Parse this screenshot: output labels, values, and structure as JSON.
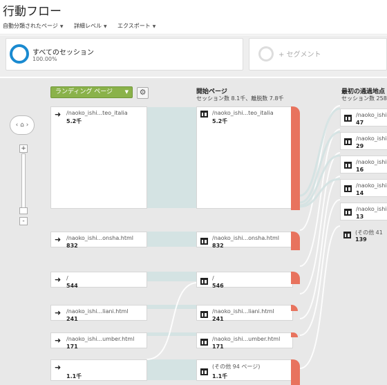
{
  "page": {
    "title": "行動フロー"
  },
  "toolbar": {
    "items": [
      {
        "label": "自動分類されたページ"
      },
      {
        "label": "詳細レベル"
      },
      {
        "label": "エクスポート"
      }
    ]
  },
  "segments": {
    "active": {
      "name": "すべてのセッション",
      "percent": "100.00%"
    },
    "add_label": "+ セグメント"
  },
  "zoom": {
    "home_icon": "home-icon",
    "plus": "+",
    "minus": "-"
  },
  "dimension": {
    "selected": "ランディング ページ"
  },
  "columns": {
    "start": {
      "title": "開始ページ",
      "subtitle": "セッション数 8.1千、離脱数 7.8千"
    },
    "first": {
      "title": "最初の通過地点",
      "subtitle": "セッション数 258..."
    }
  },
  "landing_nodes": [
    {
      "name": "/naoko_ishi...teo_italia",
      "value": "5.2千"
    },
    {
      "name": "/naoko_ishi...onsha.html",
      "value": "832"
    },
    {
      "name": "/",
      "value": "544"
    },
    {
      "name": "/naoko_ishi...liani.html",
      "value": "241"
    },
    {
      "name": "/naoko_ishi...umber.html",
      "value": "171"
    },
    {
      "name": "",
      "value": "1.1千"
    }
  ],
  "start_nodes": [
    {
      "name": "/naoko_ishi...teo_italia",
      "value": "5.2千"
    },
    {
      "name": "/naoko_ishi...onsha.html",
      "value": "832"
    },
    {
      "name": "/",
      "value": "546"
    },
    {
      "name": "/naoko_ishi...liani.html",
      "value": "241"
    },
    {
      "name": "/naoko_ishi...umber.html",
      "value": "171"
    },
    {
      "name": "(その他 94 ページ)",
      "value": "1.1千"
    }
  ],
  "first_nodes": [
    {
      "name": "/naoko_ishi",
      "value": "47"
    },
    {
      "name": "/naoko_ishi",
      "value": "29"
    },
    {
      "name": "/naoko_ishi",
      "value": "16"
    },
    {
      "name": "/naoko_ishi",
      "value": "14"
    },
    {
      "name": "/naoko_ishi",
      "value": "13"
    },
    {
      "name": "(その他 41",
      "value": "139"
    }
  ],
  "colors": {
    "accent_blue": "#1a8ad0",
    "dropdown_green": "#8ab24a",
    "dropoff_red": "#e8735e",
    "flow_teal": "#d4e3e3"
  }
}
